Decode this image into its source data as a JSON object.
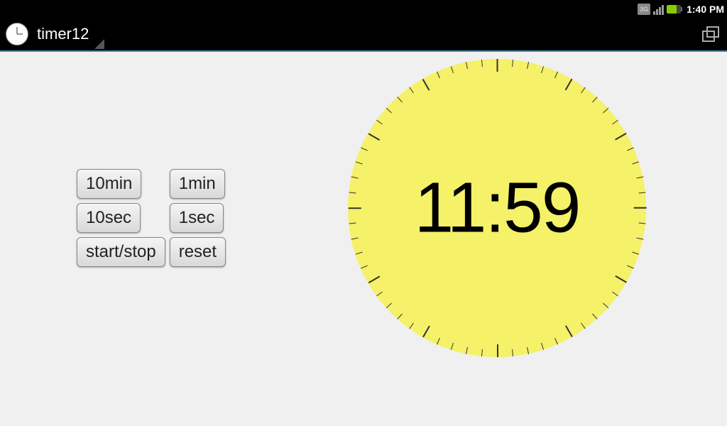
{
  "statusbar": {
    "network_label": "3G",
    "time": "1:40 PM"
  },
  "app": {
    "title": "timer12"
  },
  "buttons": {
    "ten_min": "10min",
    "one_min": "1min",
    "ten_sec": "10sec",
    "one_sec": "1sec",
    "start_stop": "start/stop",
    "reset": "reset"
  },
  "timer": {
    "display": "11:59"
  },
  "colors": {
    "clock_face": "#f5f168",
    "accent": "#3a8caa"
  }
}
